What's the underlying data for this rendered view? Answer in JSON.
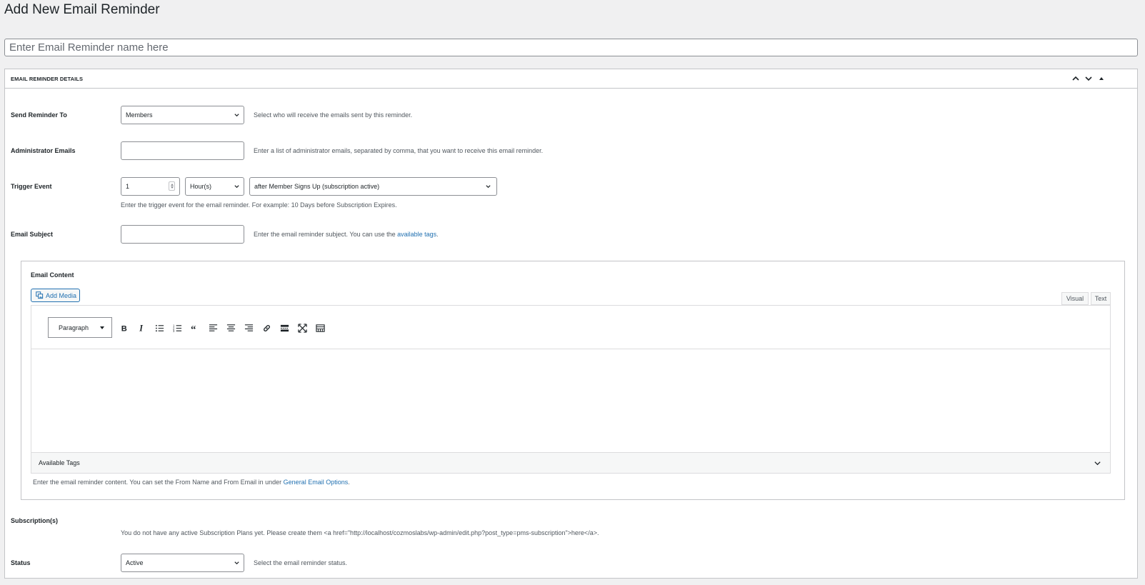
{
  "page": {
    "title": "Add New Email Reminder"
  },
  "title_input": {
    "placeholder": "Enter Email Reminder name here",
    "value": ""
  },
  "postbox": {
    "title": "EMAIL REMINDER DETAILS",
    "handles": [
      "chevron-up-icon",
      "chevron-down-icon",
      "triangle-up-icon"
    ]
  },
  "fields": {
    "send_to": {
      "label": "Send Reminder To",
      "value": "Members",
      "description": "Select who will receive the emails sent by this reminder."
    },
    "admin_emails": {
      "label": "Administrator Emails",
      "value": "",
      "description": "Enter a list of administrator emails, separated by comma, that you want to receive this email reminder."
    },
    "trigger": {
      "label": "Trigger Event",
      "number": "1",
      "unit": "Hour(s)",
      "event": "after Member Signs Up (subscription active)",
      "description": "Enter the trigger event for the email reminder. For example: 10 Days before Subscription Expires."
    },
    "subject": {
      "label": "Email Subject",
      "value": "",
      "description_prefix": "Enter the email reminder subject. You can use the ",
      "description_link": "available tags",
      "description_suffix": "."
    },
    "content": {
      "label": "Email Content",
      "add_media": "Add Media",
      "tabs": [
        "Visual",
        "Text"
      ],
      "format": "Paragraph",
      "toolbar_icons": [
        "bold-icon",
        "italic-icon",
        "bullet-list-icon",
        "numbered-list-icon",
        "blockquote-icon",
        "align-left-icon",
        "align-center-icon",
        "align-right-icon",
        "link-icon",
        "read-more-icon",
        "fullscreen-icon",
        "toolbar-toggle-icon"
      ],
      "available_tags": "Available Tags",
      "description_prefix": "Enter the email reminder content. You can set the From Name and From Email in under ",
      "description_link": "General Email Options",
      "description_suffix": "."
    },
    "subscriptions": {
      "label": "Subscription(s)",
      "description": "You do not have any active Subscription Plans yet. Please create them <a href=\"http://localhost/cozmoslabs/wp-admin/edit.php?post_type=pms-subscription\">here</a>."
    },
    "status": {
      "label": "Status",
      "value": "Active",
      "description": "Select the email reminder status."
    }
  },
  "colors": {
    "link": "#2271b1",
    "border": "#c3c4c7",
    "background": "#f0f0f1"
  }
}
